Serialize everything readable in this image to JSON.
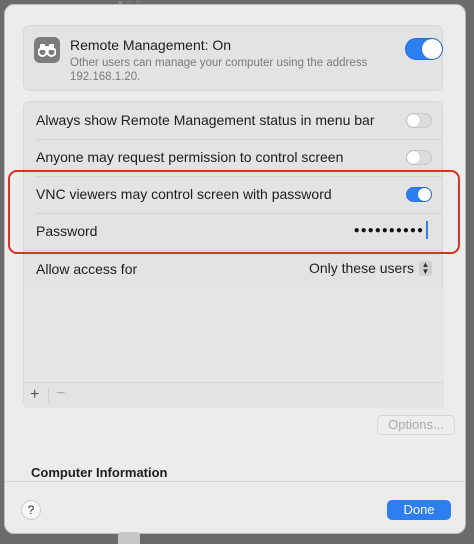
{
  "remote_management": {
    "title": "Remote Management: On",
    "description": "Other users can manage your computer using the address 192.168.1.20.",
    "enabled": true
  },
  "settings": {
    "menu_bar_status": {
      "label": "Always show Remote Management status in menu bar",
      "enabled": false
    },
    "request_permission": {
      "label": "Anyone may request permission to control screen",
      "enabled": false
    },
    "vnc_password": {
      "label": "VNC viewers may control screen with password",
      "enabled": true
    },
    "password": {
      "label": "Password",
      "value": "●●●●●●●●●●"
    },
    "allow_access": {
      "label": "Allow access for",
      "selected": "Only these users"
    }
  },
  "list_controls": {
    "add": "+",
    "remove": "−"
  },
  "options_button": "Options...",
  "computer_information_header": "Computer Information",
  "footer": {
    "help": "?",
    "done": "Done"
  },
  "colors": {
    "accent": "#2d7ff0",
    "highlight": "#d9331f"
  }
}
